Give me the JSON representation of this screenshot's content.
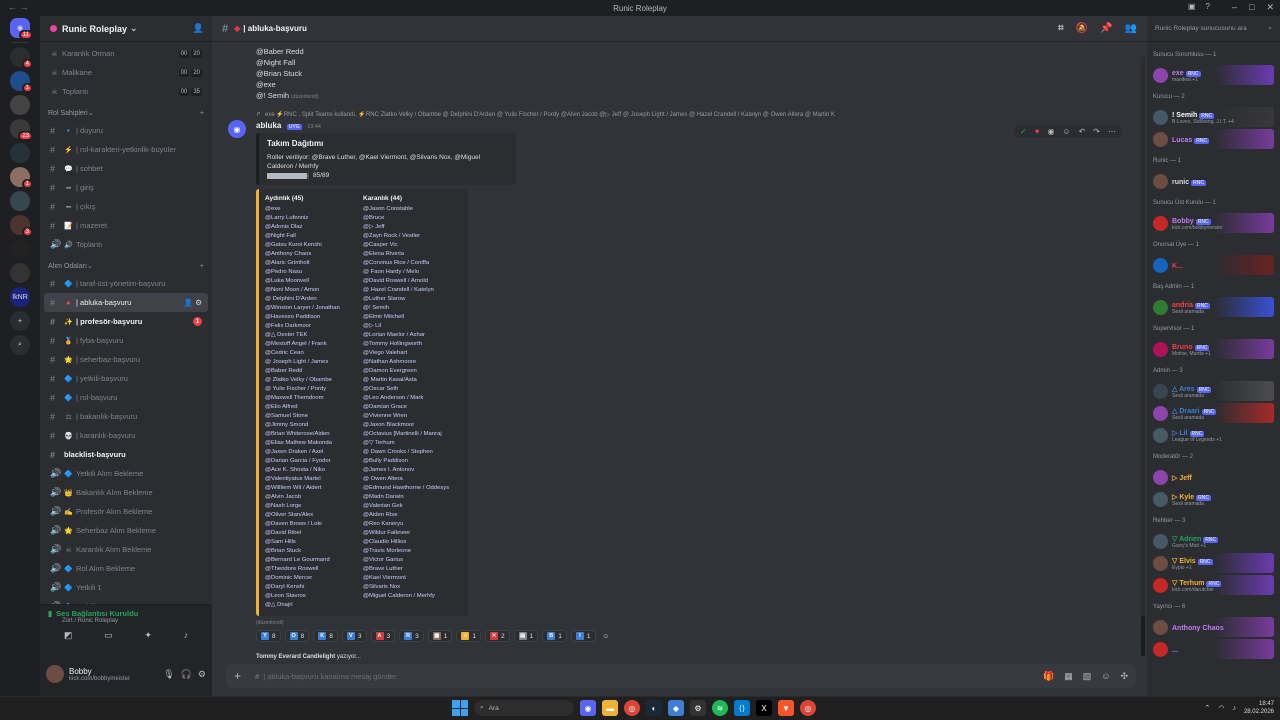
{
  "window": {
    "title": "Runic Roleplay"
  },
  "rail": {
    "server_badges": [
      "11",
      "4",
      "1",
      "",
      "23",
      "",
      "1",
      "",
      "3",
      "",
      "",
      "",
      "",
      ""
    ]
  },
  "sidebar": {
    "server_name": "Runic Roleplay",
    "top_channels": [
      {
        "name": "Karanlık Orman",
        "c1": "00",
        "c2": "20"
      },
      {
        "name": "Malikane",
        "c1": "00",
        "c2": "20"
      },
      {
        "name": "Toplantı",
        "c1": "00",
        "c2": "35"
      }
    ],
    "cat_roles": "Rol Sahipleri",
    "role_channels": [
      "| duyuru",
      "| rol-karakteri-yetkinlik-büyüler",
      "| sohbet",
      "| giriş",
      "| çıkış",
      "| mazeret",
      "Toplantı"
    ],
    "cat_recruit": "Alım Odaları",
    "recruit_channels": [
      "| taraf-üst-yönetim-başvuru",
      "| abluka-başvuru",
      "| profesör-başvuru",
      "| fyba-başvuru",
      "| seherbaz-başvuru",
      "| yetkili-başvuru",
      "| rol-başvuru",
      "| bakanlık-başvuru",
      "| karanlık-başvuru",
      "blacklist-başvuru",
      "Yetkili Alım Bekleme",
      "Bakanlık Alım Bekleme",
      "Profesör Alım Bekleme",
      "Seherbaz Alım Bekleme",
      "Karanlık Alım Bekleme",
      "Rol Alım Bekleme",
      "Yetkili 1",
      "Yetkili 2"
    ],
    "profesor_badge": "1",
    "voice_status": "Ses Bağlantısı Kuruldu",
    "voice_server": "Zort / Runic Roleplay",
    "user_name": "Bobby",
    "user_status": "kick.com/bobbymeister"
  },
  "chat": {
    "channel": "| abluka-başvuru",
    "prev_lines": [
      "@Baber Redd",
      "@Night Fall",
      "@Brian Stuck",
      "@exe",
      "@! Semih"
    ],
    "edited_label": "(düzenlendi)",
    "reply_text": "exe ⚡RNC , Split Teams kullandı. ⚡RNC Zlatko Velky / Obambe  @ Delphini D'Arden  @ Yulis Fischer / Pordy  @Alvin Jacob  @▷ Jeff  @ Joseph Light / James  @ Hazel Crandell / Katelyn  @ Owen Altera  @ Martin K",
    "author": "abluka",
    "app_tag": "UYG",
    "time": "19:44",
    "embed_title": "Takım Dağıtımı",
    "embed_desc": "Roller veriliyor: @Brave Luther, @Kael Viermont, @Silvaris Nox, @Miguel Calderon / Merhfy",
    "progress_text": "85/89",
    "progress_value": 0.955,
    "team1_title": "Aydınlık (45)",
    "team1": [
      "@exe",
      "@Larry Lufenniz",
      "@Adonis Dlaz",
      "@Night Fall",
      "@Gatsu Kuroi Kenshi",
      "@Anthony Chaos",
      "@Alaric Grimholt",
      "@Pedro Nasu",
      "@Luka Moonvell",
      "@Noni Moon / Amon",
      "@ Delphini D'Arden",
      "@Winston Laryer / Jonathan",
      "@Havesso Paddison",
      "@Felix Darkmoor",
      "@△ Dexter TEK",
      "@Mestoff Angel / Frank",
      "@Cedric Cean",
      "@ Joseph Light / James",
      "@Baber Redd",
      "@ Zlatko Velky / Obambe",
      "@ Yulis Fischer / Pordy",
      "@Maxwell Themdoom",
      "@Elio Alfred",
      "@Samuel Stone",
      "@Jimmy Smond",
      "@Brian Whiterose/Aiden",
      "@Elias Mathew Makonda",
      "@Jaxen Draken / Axel",
      "@Darian Garcia / Fyodor",
      "@Ace K. Shosta / Niko",
      "@Valentiyatus Martel",
      "@Willliem Wit / Aidert",
      "@Alvin Jacob",
      "@Nash Lorge",
      "@Oliver Stan/Alex",
      "@Daven Brows / Loki",
      "@David Ribel",
      "@Sam Hills",
      "@Brian Stuck",
      "@Bernard Le Gourmand",
      "@Theodore Roswell",
      "@Dominic Mercer",
      "@Daryl Kenshi",
      "@Leon Stavros",
      "@△ Dnajrl"
    ],
    "team2_title": "Karanlık (44)",
    "team2": [
      "@Jason Constable",
      "@Bruce",
      "@▷ Jeff",
      "@Zayn Rock / Vestler",
      "@Casper Vic",
      "@Elena Riveria",
      "@Corvinus Rice / Coniffa",
      "@ Faon Hardy / Melo",
      "@David Roswell / Arnold",
      "@ Hazel Crandell / Katelyn",
      "@Luther Slarow",
      "@! Semih",
      "@Elmir Mitchell",
      "@▷ Lil",
      "@Lorian Maelor / Ashar",
      "@Tommy Hollingworth",
      "@Viego Valehart",
      "@Nathan Ashmoore",
      "@Damon Evergreen",
      "@ Martin Kasai/Asta",
      "@Oscar Seth",
      "@Leo Anderson / Mark",
      "@Damian Grace",
      "@Vivienne Wren",
      "@Jaxon Blackmoor",
      "@Octavius [Martinelli / Manraj",
      "@▽ Terhum",
      "@ Dawn Crooks / Stephen",
      "@Bully Paddison",
      "@James I. Antonov",
      "@ Owen Altera",
      "@Edmund Hawthorne / Oddesys",
      "@Madn Darwin",
      "@Valerian Gek",
      "@Aiden Rise",
      "@Reo Kaneryu",
      "@Wildur Falkneer",
      "@Claudio Hillios",
      "@Travis Morleone",
      "@Victor Garius",
      "@Brave Luther",
      "@Kael Viermont",
      "@Silvaris Nox",
      "@Miguel Calderon / Merhfy"
    ],
    "edited_label2": "(düzenlendi)",
    "reactions": [
      {
        "label": "Y",
        "count": "8",
        "color": "#3d7fd6"
      },
      {
        "label": "O",
        "count": "8",
        "color": "#3d7fd6"
      },
      {
        "label": "K",
        "count": "8",
        "color": "#3d7fd6"
      },
      {
        "label": "V",
        "count": "3",
        "color": "#3d7fd6"
      },
      {
        "label": "A",
        "count": "3",
        "color": "#d83c3e"
      },
      {
        "label": "R",
        "count": "3",
        "color": "#3d7fd6"
      },
      {
        "label": "▦",
        "count": "1",
        "color": "#8d6e63"
      },
      {
        "label": "☺",
        "count": "1",
        "color": "#f0b232"
      },
      {
        "label": "✕",
        "count": "2",
        "color": "#d83c3e"
      },
      {
        "label": "▤",
        "count": "1",
        "color": "#80848e"
      },
      {
        "label": "B",
        "count": "1",
        "color": "#3d7fd6"
      },
      {
        "label": "I",
        "count": "1",
        "color": "#3d7fd6"
      }
    ],
    "typing": "Tommy Everard Candlelight",
    "typing_suffix": "yazıyor...",
    "composer_placeholder": "| abluka-başvuru kanalına mesaj gönder"
  },
  "members": {
    "search_placeholder": "Runic Roleplay sunucusunu ara",
    "groups": [
      {
        "title": "Sunucu Sorumlusu — 1",
        "items": [
          {
            "name": "exe",
            "status": "manifest +1",
            "color": "#c27cf2",
            "tag": "RNC",
            "grad": "linear-gradient(90deg, transparent, #7a3fcf)"
          }
        ]
      },
      {
        "title": "Kurucu — 2",
        "items": [
          {
            "name": "! Semih",
            "status": "B-Loves, Skillbeng, J.I.T. +4",
            "color": "#ffffff",
            "tag": "RNC",
            "grad": "linear-gradient(90deg, transparent, #3b3b3b)"
          },
          {
            "name": "Lucas",
            "status": "",
            "color": "#c27cf2",
            "tag": "RNC",
            "grad": "linear-gradient(90deg, transparent, #8b3fb8)"
          }
        ]
      },
      {
        "title": "Runic — 1",
        "items": [
          {
            "name": "runic",
            "status": "",
            "color": "#dbdee1",
            "tag": "RNC",
            "grad": ""
          }
        ]
      },
      {
        "title": "Sunucu Üst Kurulu — 1",
        "items": [
          {
            "name": "Bobby",
            "status": "kick.com/bobbymeister",
            "color": "#c27cf2",
            "tag": "RNC",
            "grad": "linear-gradient(90deg, transparent, #8b3fb8)"
          }
        ]
      },
      {
        "title": "Onursal Üye — 1",
        "items": [
          {
            "name": "K...",
            "status": "",
            "color": "#f23f43",
            "tag": "",
            "grad": "linear-gradient(90deg, transparent, #7a1f1f)"
          }
        ]
      },
      {
        "title": "Baş Admin — 1",
        "items": [
          {
            "name": "andria",
            "status": "Sesli aramada",
            "color": "#f23f43",
            "tag": "RNC",
            "grad": "linear-gradient(90deg, transparent, #3d5afe)"
          }
        ]
      },
      {
        "title": "Supervisor — 1",
        "items": [
          {
            "name": "Bruno",
            "status": "Motive, Murda +1",
            "color": "#f23f43",
            "tag": "RNC",
            "grad": "linear-gradient(90deg, transparent, #8b3fb8)"
          }
        ]
      },
      {
        "title": "Admin — 3",
        "items": [
          {
            "name": "△ Ares",
            "status": "Sesli aramada",
            "color": "#3d7fd6",
            "tag": "RNC",
            "grad": "linear-gradient(90deg, transparent, #555)"
          },
          {
            "name": "△ Draari",
            "status": "Sesli aramada",
            "color": "#3d7fd6",
            "tag": "RNC",
            "grad": "linear-gradient(90deg, transparent, #c62828)"
          },
          {
            "name": "▷ Lil",
            "status": "League of Legends +1",
            "color": "#3d7fd6",
            "tag": "RNC",
            "grad": ""
          }
        ]
      },
      {
        "title": "Moderatör — 2",
        "items": [
          {
            "name": "▷ Jeff",
            "status": "",
            "color": "#f0b232",
            "tag": "",
            "grad": ""
          },
          {
            "name": "▷ Kyle",
            "status": "Sesli aramada",
            "color": "#f0b232",
            "tag": "RNC",
            "grad": ""
          }
        ]
      },
      {
        "title": "Rehber — 3",
        "items": [
          {
            "name": "▽ Adrien",
            "status": "Garry's Mod +1",
            "color": "#23a55a",
            "tag": "RNC",
            "grad": ""
          },
          {
            "name": "▽ Elvis",
            "status": "Eypio +1",
            "color": "#f0b232",
            "tag": "RNC",
            "grad": "linear-gradient(90deg, transparent, #7a3fcf)"
          },
          {
            "name": "▽ Terhum",
            "status": "kick.com/darutcher",
            "color": "#f0b232",
            "tag": "RNC",
            "grad": "linear-gradient(90deg, transparent, #7a3fcf)"
          }
        ]
      },
      {
        "title": "Yayıncı — 6",
        "items": [
          {
            "name": "Anthony Chaos",
            "status": "",
            "color": "#c27cf2",
            "tag": "",
            "grad": "linear-gradient(90deg, transparent, #8b3fb8)"
          },
          {
            "name": "...",
            "status": "",
            "color": "#c27cf2",
            "tag": "",
            "grad": "linear-gradient(90deg, transparent, #8b3fb8)"
          }
        ]
      }
    ]
  },
  "taskbar": {
    "search_label": "Ara",
    "time": "18:47",
    "date": "28.02.2026"
  }
}
